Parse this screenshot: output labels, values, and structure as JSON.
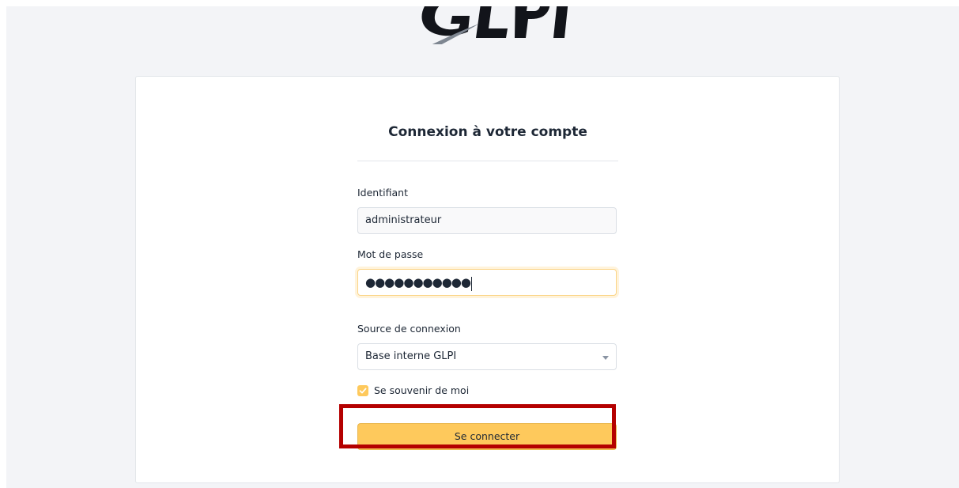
{
  "login": {
    "title": "Connexion à votre compte",
    "username_label": "Identifiant",
    "username_value": "administrateur",
    "password_label": "Mot de passe",
    "password_value": "●●●●●●●●●●●",
    "source_label": "Source de connexion",
    "source_selected": "Base interne GLPI",
    "remember_label": "Se souvenir de moi",
    "remember_checked": true,
    "submit_label": "Se connecter"
  },
  "colors": {
    "accent": "#fec95c",
    "page_bg": "#f3f4f7",
    "card_bg": "#ffffff",
    "text": "#1d2735",
    "highlight": "#b40000"
  },
  "icons": {
    "logo": "glpi-logo",
    "select_arrow": "chevron-down-icon",
    "check": "check-icon"
  }
}
